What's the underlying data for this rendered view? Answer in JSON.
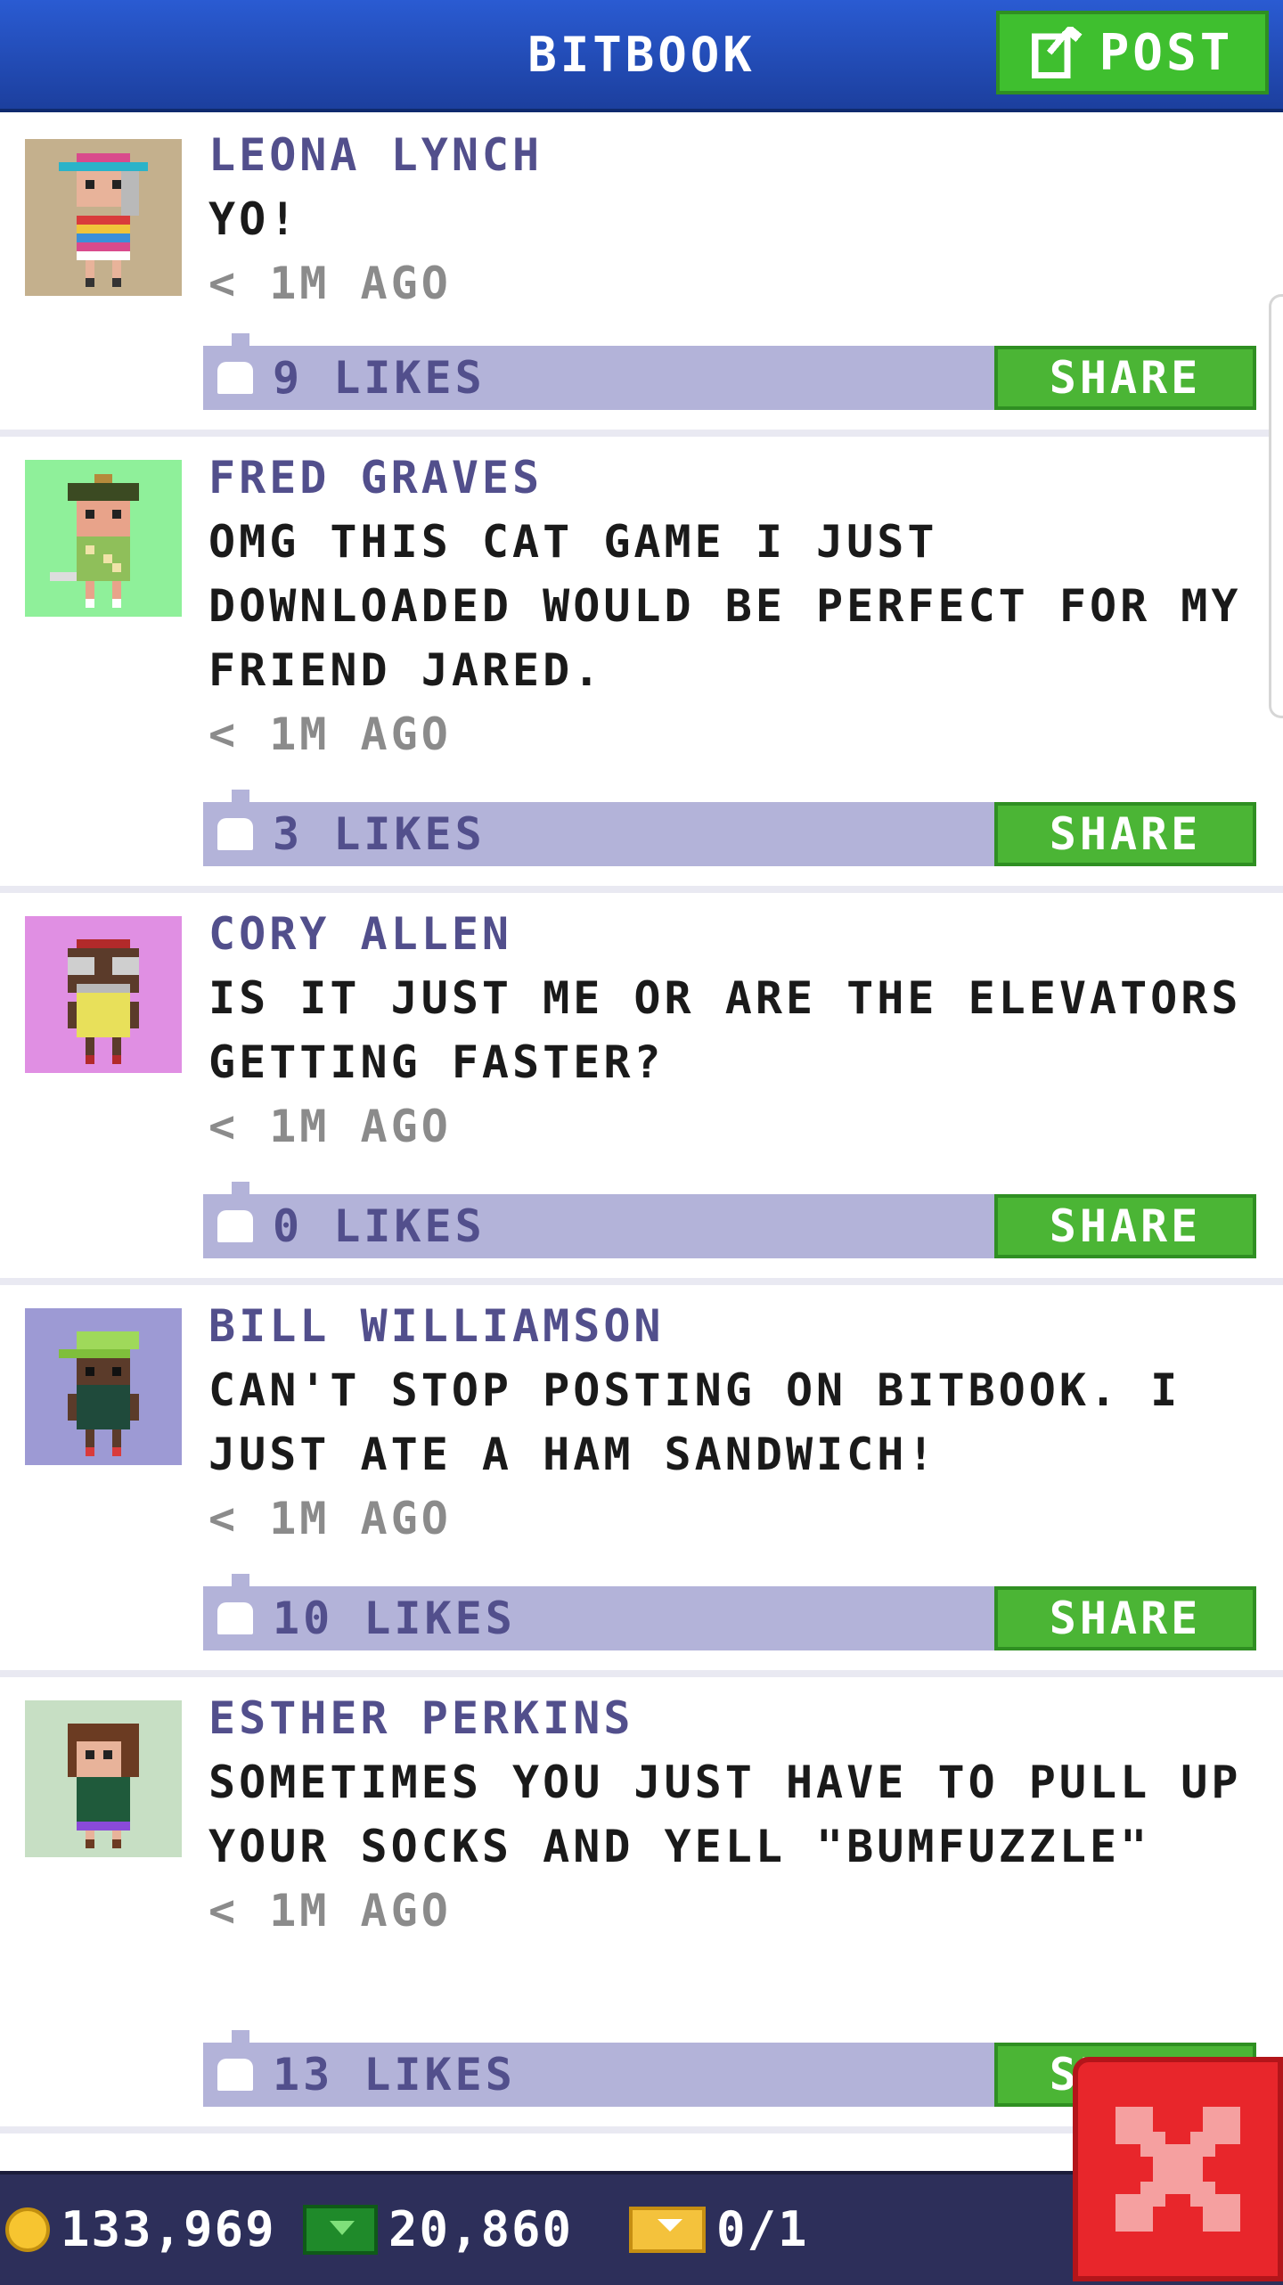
{
  "header": {
    "title": "BITBOOK",
    "post_label": "POST"
  },
  "posts": [
    {
      "name": "LEONA LYNCH",
      "message": "YO!",
      "time": "< 1M AGO",
      "likes": "9 LIKES",
      "share_label": "SHARE",
      "avatar_bg": "#c4b08d"
    },
    {
      "name": "FRED GRAVES",
      "message": "OMG THIS CAT GAME I JUST DOWNLOADED WOULD BE PERFECT FOR MY FRIEND JARED.",
      "time": "< 1M AGO",
      "likes": "3 LIKES",
      "share_label": "SHARE",
      "avatar_bg": "#8ff09a"
    },
    {
      "name": "CORY ALLEN",
      "message": "IS IT JUST ME OR ARE THE ELEVATORS GETTING FASTER?",
      "time": "< 1M AGO",
      "likes": "0 LIKES",
      "share_label": "SHARE",
      "avatar_bg": "#e08fe3"
    },
    {
      "name": "BILL WILLIAMSON",
      "message": "CAN'T STOP POSTING ON BITBOOK. I JUST ATE A HAM SANDWICH!",
      "time": "< 1M AGO",
      "likes": "10 LIKES",
      "share_label": "SHARE",
      "avatar_bg": "#9d9ad4"
    },
    {
      "name": "ESTHER PERKINS",
      "message": "SOMETIMES YOU JUST HAVE TO PULL UP YOUR SOCKS AND YELL \"BUMFUZZLE\"",
      "time": "< 1M AGO",
      "likes": "13 LIKES",
      "share_label": "SHARE",
      "avatar_bg": "#c7dfc4"
    }
  ],
  "bottom_bar": {
    "coins": "133,969",
    "bux": "20,860",
    "tickets": "0/1"
  },
  "colors": {
    "header_blue": "#2a5bd2",
    "share_green": "#4bb535",
    "likes_bar": "#b3b3d9",
    "close_red": "#e8262b"
  }
}
